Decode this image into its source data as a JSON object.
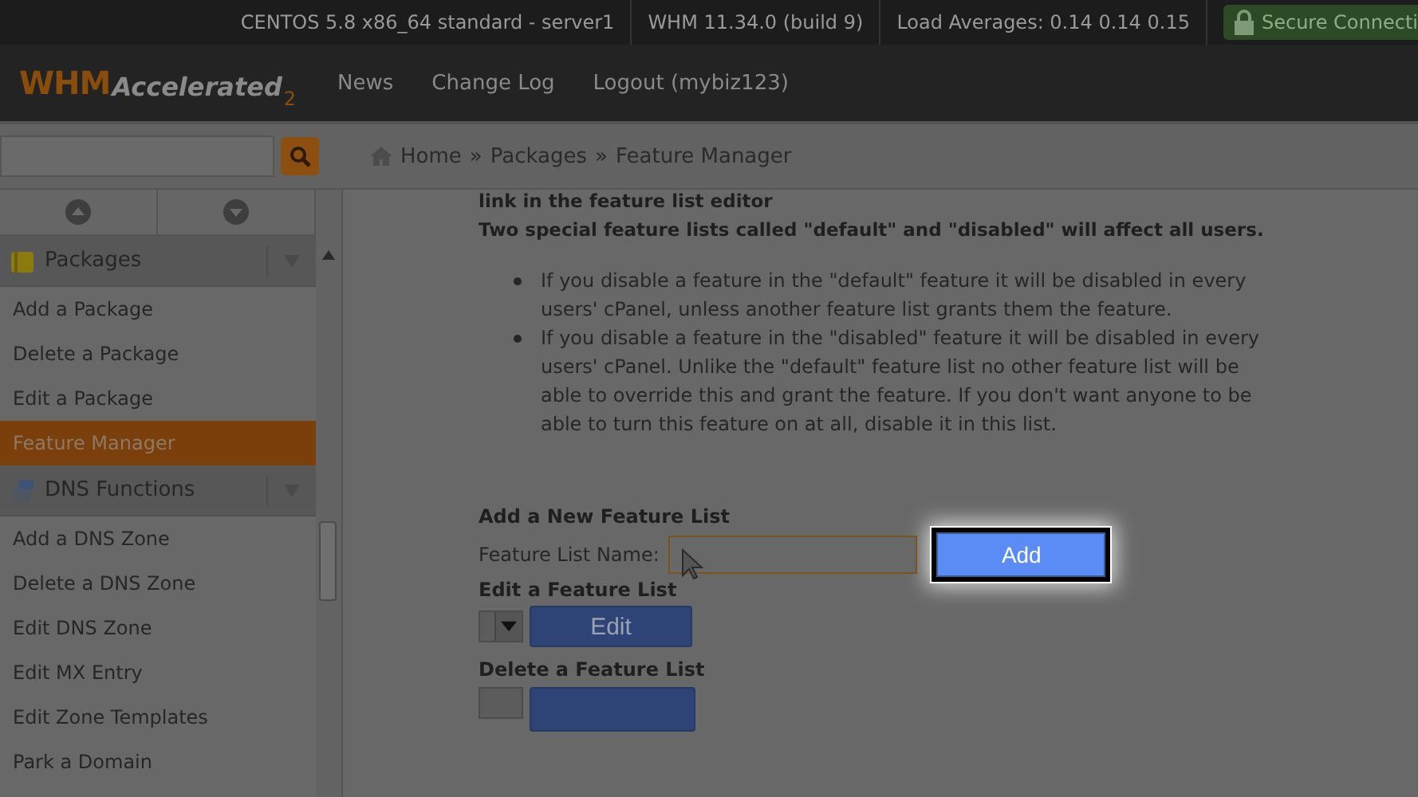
{
  "status_bar": {
    "items": [
      "CENTOS 5.8 x86_64 standard - server1",
      "WHM 11.34.0 (build 9)",
      "Load Averages: 0.14 0.14 0.15"
    ],
    "secure": "Secure Connecti"
  },
  "header": {
    "logo": {
      "main": "WHM",
      "sub": "Accelerated",
      "version": "2"
    },
    "links": [
      "News",
      "Change Log",
      "Logout (mybiz123)"
    ]
  },
  "breadcrumb": [
    {
      "label": "Home"
    },
    {
      "separator": "»",
      "label": "Packages"
    },
    {
      "separator": "»",
      "label": "Feature Manager"
    }
  ],
  "sidebar": {
    "groups": [
      {
        "title": "Packages",
        "items": [
          {
            "label": "Add a Package",
            "selected": false
          },
          {
            "label": "Delete a Package",
            "selected": false
          },
          {
            "label": "Edit a Package",
            "selected": false
          },
          {
            "label": "Feature Manager",
            "selected": true
          }
        ]
      },
      {
        "title": "DNS Functions",
        "items": [
          {
            "label": "Add a DNS Zone",
            "selected": false
          },
          {
            "label": "Delete a DNS Zone",
            "selected": false
          },
          {
            "label": "Edit DNS Zone",
            "selected": false
          },
          {
            "label": "Edit MX Entry",
            "selected": false
          },
          {
            "label": "Edit Zone Templates",
            "selected": false
          },
          {
            "label": "Park a Domain",
            "selected": false
          }
        ]
      }
    ]
  },
  "content": {
    "intro": [
      "link in the feature list editor",
      "Two special feature lists called \"default\" and \"disabled\" will affect all users."
    ],
    "bullets": [
      "If you disable a feature in the \"default\" feature it will be disabled in every users' cPanel, unless another feature list grants them the feature.",
      "If you disable a feature in the \"disabled\" feature it will be disabled in every users' cPanel. Unlike the \"default\" feature list no other feature list will be able to override this and grant the feature. If you don't want anyone to be able to turn this feature on at all, disable it in this list."
    ],
    "add_section": {
      "heading": "Add a New Feature List",
      "label": "Feature List Name:",
      "focused": true,
      "button": {
        "label": "Add",
        "highlighted": true
      }
    },
    "edit_section": {
      "heading": "Edit a Feature List",
      "button": "Edit"
    },
    "delete_section": {
      "heading": "Delete a Feature List"
    }
  }
}
